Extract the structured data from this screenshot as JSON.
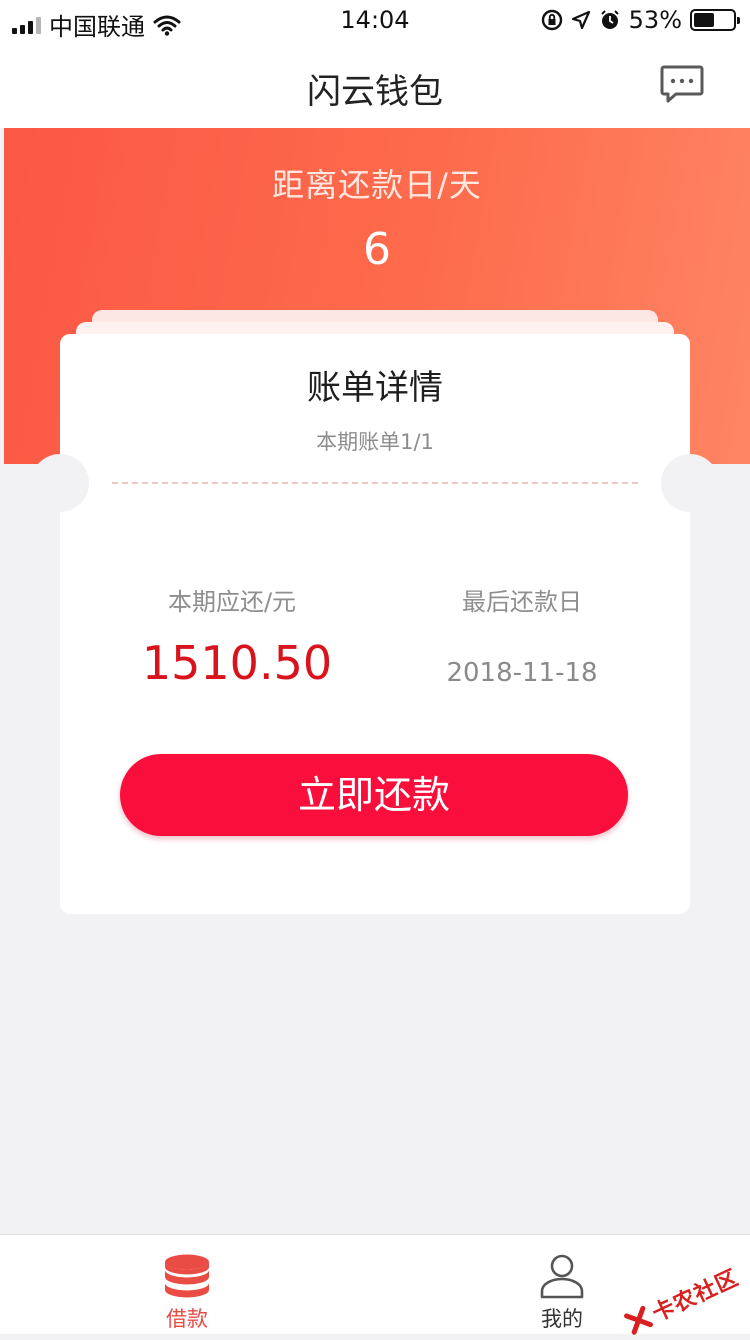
{
  "status_bar": {
    "carrier": "中国联通",
    "time": "14:04",
    "battery": "53%",
    "battery_level": 0.53
  },
  "nav": {
    "title": "闪云钱包",
    "message_icon": "chat-bubble-icon"
  },
  "hero": {
    "label": "距离还款日/天",
    "days": "6",
    "colors": {
      "start": "#fb5845",
      "end": "#fe8563"
    }
  },
  "bill": {
    "title": "账单详情",
    "period": "本期账单1/1",
    "amount_label": "本期应还/元",
    "amount": "1510.50",
    "due_label": "最后还款日",
    "due_date": "2018-11-18",
    "repay_button": "立即还款",
    "colors": {
      "amount": "#d8131c",
      "button": "#fa0e3c"
    }
  },
  "tab_bar": {
    "items": [
      {
        "label": "借款",
        "icon": "coin-stack-icon",
        "active": true
      },
      {
        "label": "我的",
        "icon": "user-icon",
        "active": false
      }
    ],
    "colors": {
      "active": "#e94b45"
    }
  },
  "watermark": {
    "text": "卡农社区"
  }
}
